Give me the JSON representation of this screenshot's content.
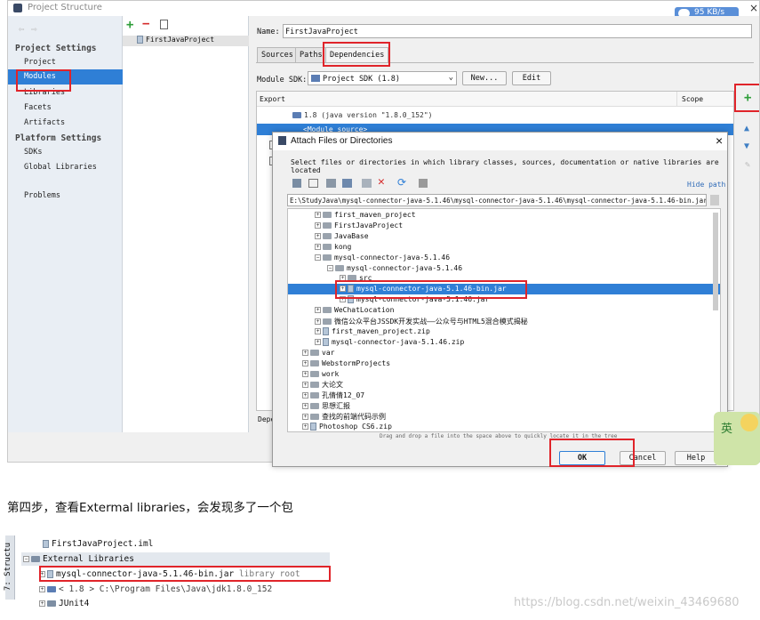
{
  "window": {
    "title": "Project Structure",
    "close_glyph": "×",
    "speed": "95 KB/s"
  },
  "left_panel": {
    "project_settings": "Project Settings",
    "items_ps": [
      "Project",
      "Modules",
      "Libraries",
      "Facets",
      "Artifacts"
    ],
    "platform_settings": "Platform Settings",
    "items_pf": [
      "SDKs",
      "Global Libraries"
    ],
    "problems": "Problems"
  },
  "middle": {
    "module": "FirstJavaProject"
  },
  "right": {
    "name_label": "Name:",
    "name_value": "FirstJavaProject",
    "tabs": [
      "Sources",
      "Paths",
      "Dependencies"
    ],
    "sdk_label": "Module SDK:",
    "sdk_value": "Project SDK (1.8)",
    "new_btn": "New...",
    "edit_btn": "Edit",
    "col_export": "Export",
    "col_scope": "Scope",
    "row1": "1.8 (java version \"1.8.0_152\")",
    "row2": "<Module source>",
    "depen": "Depen"
  },
  "dialog": {
    "title": "Attach Files or Directories",
    "close": "×",
    "desc": "Select files or directories in which library classes, sources, documentation or native libraries are located",
    "hide_path": "Hide path",
    "path": "E:\\StudyJava\\mysql-connector-java-5.1.46\\mysql-connector-java-5.1.46\\mysql-connector-java-5.1.46-bin.jar",
    "tree": [
      "first_maven_project",
      "FirstJavaProject",
      "JavaBase",
      "kong",
      "mysql-connector-java-5.1.46",
      "mysql-connector-java-5.1.46",
      "src",
      "mysql-connector-java-5.1.46-bin.jar",
      "mysql-connector-java-5.1.46.jar",
      "WeChatLocation",
      "微信公众平台JSSDK开发实战——公众号与HTML5混合模式揭秘",
      "first_maven_project.zip",
      "mysql-connector-java-5.1.46.zip",
      "var",
      "WebstormProjects",
      "work",
      "大论文",
      "孔倩倩12_07",
      "思想汇报",
      "查找的前端代码示例",
      "Photoshop CS6.zip"
    ],
    "drag_hint": "Drag and drop a file into the space above to quickly locate it in the tree",
    "ok": "OK",
    "cancel": "Cancel",
    "help": "Help"
  },
  "ime": {
    "label": "英"
  },
  "step_text": "第四步，查看Extermal libraries，会发现多了一个包",
  "bottom": {
    "structure_tab": "7: Structu",
    "iml": "FirstJavaProject.iml",
    "ext": "External Libraries",
    "jar": "mysql-connector-java-5.1.46-bin.jar",
    "jar_suffix": "library root",
    "jdk": "< 1.8 > C:\\Program Files\\Java\\jdk1.8.0_152",
    "junit": "JUnit4"
  },
  "watermark": "https://blog.csdn.net/weixin_43469680",
  "colors": {
    "selection": "#2f7fd6",
    "highlight_box": "#e0242a",
    "plus_green": "#2e9e3a",
    "minus_red": "#d52b2b"
  }
}
